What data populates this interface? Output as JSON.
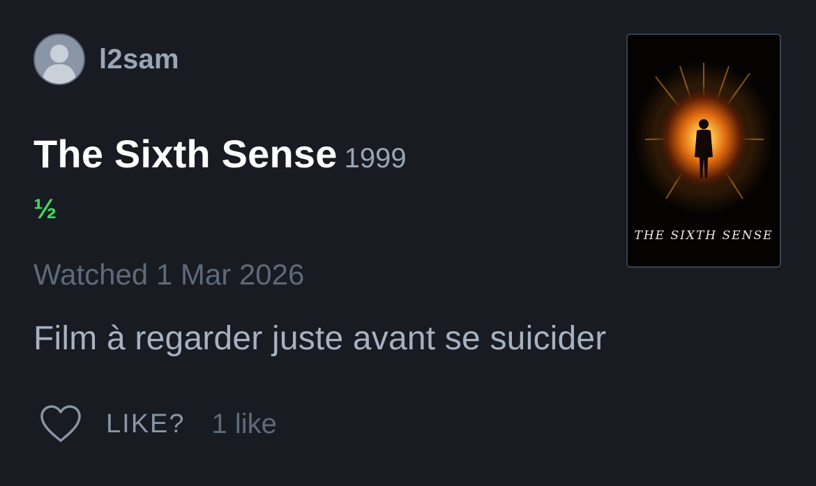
{
  "author": {
    "username": "l2sam",
    "avatar_icon": "user-silhouette-icon"
  },
  "film": {
    "title": "The Sixth Sense",
    "year": "1999"
  },
  "rating": "½",
  "watched": "Watched 1 Mar 2026",
  "review_text": "Film à regarder juste avant se suicider",
  "actions": {
    "like_icon": "heart-outline-icon",
    "like_label": "LIKE?",
    "like_count": "1 like"
  },
  "poster": {
    "caption": "THE SIXTH SENSE"
  },
  "colors": {
    "background": "#181b21",
    "rating": "#3ddc5c",
    "title": "#ffffff",
    "muted": "#5e6a7a",
    "secondary": "#9aa6b6"
  }
}
